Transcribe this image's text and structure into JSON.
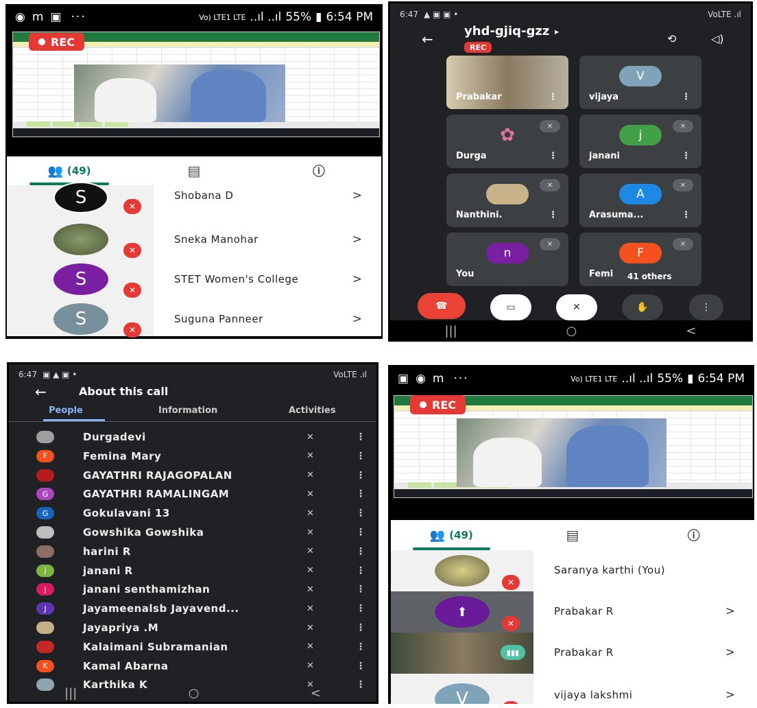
{
  "status_light": {
    "carrier": "Vo) LTE1 LTE",
    "signal": "..ıl ..ıl",
    "battery": "55%",
    "time": "6:54 PM"
  },
  "status_dark": {
    "time": "6:47",
    "right": "VoLTE .ıl"
  },
  "rec_label": "REC",
  "panel_a": {
    "count": "(49)",
    "participants": [
      {
        "name": "Shobana D",
        "initial": "S",
        "color": "#111111"
      },
      {
        "name": "Sneka Manohar",
        "initial": "",
        "color": "#6d7d52"
      },
      {
        "name": "STET Women's College",
        "initial": "S",
        "color": "#7b1fa2"
      },
      {
        "name": "Suguna Panneer",
        "initial": "S",
        "color": "#78909c"
      }
    ],
    "chevron": ">"
  },
  "panel_b": {
    "meeting_code": "yhd-gjiq-gzz",
    "code_arrow": "▸",
    "tiles": [
      {
        "name": "Prabakar",
        "initial": "",
        "color": "#8a7a60"
      },
      {
        "name": "vijaya",
        "initial": "V",
        "color": "#7fa3b8"
      },
      {
        "name": "Durga",
        "initial": "✿",
        "color": "#3c4043"
      },
      {
        "name": "janani",
        "initial": "j",
        "color": "#43a047"
      },
      {
        "name": "Nanthini.",
        "initial": "",
        "color": "#c9b38a"
      },
      {
        "name": "Arasuma...",
        "initial": "A",
        "color": "#1e88e5"
      },
      {
        "name": "You",
        "initial": "n",
        "color": "#7b1fa2"
      },
      {
        "name": "Femi",
        "initial": "F",
        "color": "#f4511e"
      }
    ],
    "others": "41 others",
    "more": "⋮"
  },
  "panel_c": {
    "title": "About this call",
    "tabs": [
      "People",
      "Information",
      "Activities"
    ],
    "people": [
      {
        "name": "Durgadevi",
        "initial": "",
        "color": "#9e9e9e"
      },
      {
        "name": "Femina Mary",
        "initial": "F",
        "color": "#f4511e"
      },
      {
        "name": "GAYATHRI RAJAGOPALAN",
        "initial": "",
        "color": "#b71c1c"
      },
      {
        "name": "GAYATHRI RAMALINGAM",
        "initial": "G",
        "color": "#ab47bc"
      },
      {
        "name": "Gokulavani 13",
        "initial": "G",
        "color": "#1565c0"
      },
      {
        "name": "Gowshika Gowshika",
        "initial": "",
        "color": "#bdbdbd"
      },
      {
        "name": "harini R",
        "initial": "",
        "color": "#8d6e63"
      },
      {
        "name": "janani R",
        "initial": "j",
        "color": "#7cb342"
      },
      {
        "name": "janani senthamizhan",
        "initial": "j",
        "color": "#d81b60"
      },
      {
        "name": "Jayameenalsb Jayavend...",
        "initial": "J",
        "color": "#5e35b1"
      },
      {
        "name": "Jayapriya .M",
        "initial": "",
        "color": "#c5b08a"
      },
      {
        "name": "Kalaimani Subramanian",
        "initial": "",
        "color": "#c62828"
      },
      {
        "name": "Kamal Abarna",
        "initial": "K",
        "color": "#f4511e"
      },
      {
        "name": "Karthika K",
        "initial": "",
        "color": "#90a4ae"
      }
    ]
  },
  "panel_d": {
    "count": "(49)",
    "participants": [
      {
        "name": "Saranya karthi (You)",
        "initial": "",
        "color": "#8f8a5a"
      },
      {
        "name": "Prabakar R",
        "initial": "⬆",
        "color": "#6a1b9a"
      },
      {
        "name": "Prabakar R",
        "initial": "",
        "color": "#6d6450"
      },
      {
        "name": "vijaya lakshmi",
        "initial": "V",
        "color": "#7fa3b8"
      }
    ],
    "chevron": ">"
  },
  "nav": {
    "recents": "|||",
    "home": "○",
    "back": "<"
  }
}
